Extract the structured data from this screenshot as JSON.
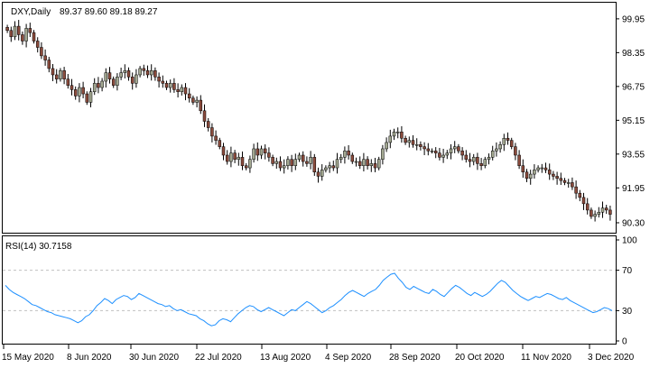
{
  "price_panel": {
    "symbol": "DXY,Daily",
    "ohlc": "89.37 89.60 89.18 89.27",
    "y_ticks": [
      "99.95",
      "98.35",
      "96.75",
      "95.15",
      "93.55",
      "91.95",
      "90.30"
    ]
  },
  "rsi_panel": {
    "label": "RSI(14) 30.7158",
    "y_ticks": [
      "100",
      "70",
      "30",
      "0"
    ],
    "levels": [
      70,
      30
    ]
  },
  "x_ticks": [
    "15 May 2020",
    "8 Jun 2020",
    "30 Jun 2020",
    "22 Jul 2020",
    "13 Aug 2020",
    "4 Sep 2020",
    "28 Sep 2020",
    "20 Oct 2020",
    "11 Nov 2020",
    "3 Dec 2020"
  ],
  "colors": {
    "bull": "#a3a891",
    "bear": "#8a4b3c",
    "rsi_line": "#1e90ff",
    "level_line": "#c0c0c0",
    "frame": "#000000"
  },
  "chart_data": {
    "type": "candlestick",
    "price_ylim": [
      90.0,
      100.5
    ],
    "rsi_ylim": [
      0,
      100
    ],
    "price_closes": [
      99.4,
      99.1,
      99.6,
      99.2,
      98.9,
      99.5,
      99.3,
      98.9,
      98.6,
      98.2,
      98.0,
      97.6,
      97.3,
      97.1,
      97.5,
      97.1,
      96.8,
      96.6,
      96.3,
      96.7,
      96.4,
      96.0,
      96.5,
      96.9,
      96.7,
      97.0,
      97.4,
      97.1,
      96.8,
      97.2,
      97.4,
      97.5,
      97.2,
      96.9,
      97.3,
      97.6,
      97.5,
      97.3,
      97.5,
      97.2,
      97.0,
      96.9,
      96.7,
      96.9,
      96.6,
      96.5,
      96.7,
      96.4,
      96.2,
      96.0,
      96.1,
      95.6,
      95.1,
      94.8,
      94.4,
      94.2,
      93.9,
      93.5,
      93.2,
      93.6,
      93.3,
      93.4,
      93.0,
      92.9,
      93.3,
      93.8,
      93.5,
      93.8,
      93.6,
      93.4,
      93.1,
      93.2,
      92.9,
      93.0,
      93.3,
      93.0,
      93.3,
      93.5,
      93.2,
      93.1,
      93.4,
      92.7,
      92.5,
      92.8,
      92.9,
      93.0,
      92.9,
      93.3,
      93.4,
      93.7,
      93.5,
      93.2,
      93.2,
      93.0,
      93.3,
      93.0,
      93.1,
      92.9,
      93.3,
      93.8,
      94.1,
      94.4,
      94.6,
      94.6,
      94.3,
      94.1,
      94.2,
      94.0,
      94.0,
      93.9,
      93.8,
      93.7,
      93.7,
      93.6,
      93.4,
      93.5,
      93.6,
      93.8,
      93.9,
      93.7,
      93.5,
      93.3,
      93.2,
      93.4,
      93.1,
      93.0,
      93.3,
      93.4,
      93.7,
      93.8,
      94.0,
      94.3,
      94.2,
      93.9,
      93.5,
      93.0,
      92.7,
      92.4,
      92.6,
      92.8,
      92.9,
      92.9,
      92.8,
      92.6,
      92.5,
      92.4,
      92.3,
      92.2,
      92.2,
      92.0,
      91.7,
      91.5,
      91.2,
      90.9,
      90.6,
      90.7,
      90.8,
      91.0,
      90.9,
      90.7
    ],
    "rsi_values": [
      55,
      51,
      48,
      46,
      44,
      42,
      39,
      36,
      35,
      33,
      31,
      29,
      28,
      26,
      25,
      24,
      23,
      22,
      20,
      18,
      20,
      24,
      26,
      30,
      35,
      38,
      42,
      40,
      37,
      41,
      43,
      45,
      44,
      41,
      43,
      47,
      45,
      43,
      41,
      39,
      37,
      36,
      34,
      35,
      32,
      30,
      31,
      29,
      27,
      26,
      25,
      22,
      20,
      17,
      15,
      16,
      20,
      22,
      21,
      19,
      23,
      27,
      30,
      33,
      35,
      34,
      31,
      29,
      31,
      33,
      31,
      29,
      27,
      25,
      28,
      31,
      30,
      33,
      36,
      39,
      37,
      34,
      31,
      28,
      30,
      33,
      35,
      38,
      41,
      45,
      48,
      50,
      48,
      46,
      44,
      47,
      49,
      51,
      55,
      60,
      63,
      66,
      67,
      62,
      58,
      53,
      51,
      54,
      52,
      50,
      48,
      47,
      51,
      49,
      46,
      44,
      48,
      52,
      55,
      53,
      50,
      47,
      45,
      48,
      46,
      44,
      46,
      49,
      53,
      57,
      60,
      58,
      54,
      50,
      47,
      44,
      42,
      40,
      42,
      44,
      43,
      45,
      47,
      46,
      44,
      42,
      41,
      43,
      40,
      38,
      36,
      34,
      32,
      30,
      28,
      29,
      31,
      33,
      32,
      30
    ]
  }
}
